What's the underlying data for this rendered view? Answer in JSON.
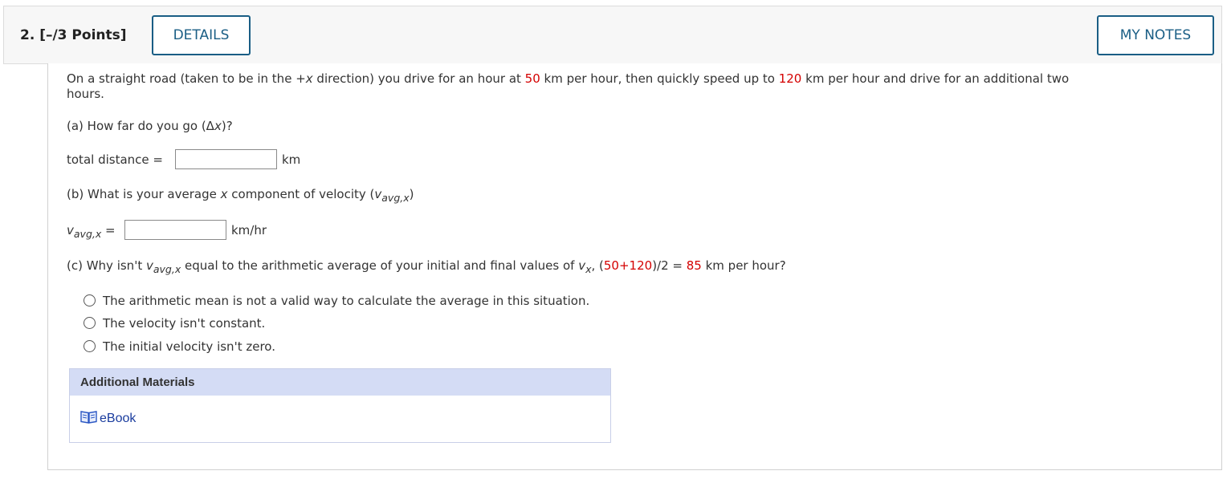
{
  "header": {
    "question_label": "2.  [–/3 Points]",
    "details_label": "DETAILS",
    "my_notes_label": "MY NOTES"
  },
  "question": {
    "intro_p1": "On a straight road (taken to be in the +",
    "intro_x": "x",
    "intro_p2": " direction) you drive for an hour at ",
    "speed1": "50",
    "intro_p3": " km per hour, then quickly speed up to ",
    "speed2": "120",
    "intro_p4": " km per hour and drive for an additional two",
    "intro_line2": "hours.",
    "part_a": {
      "prompt_p1": "(a) How far do you go (Δ",
      "prompt_x": "x",
      "prompt_p2": ")?",
      "label": "total distance =",
      "value": "",
      "unit": "km"
    },
    "part_b": {
      "prompt_p1": "(b) What is your average ",
      "prompt_x": "x",
      "prompt_p2": " component of velocity (",
      "prompt_v": "v",
      "prompt_sub": "avg,x",
      "prompt_p3": ")",
      "label_v": "v",
      "label_sub": "avg,x",
      "label_eq": " =",
      "value": "",
      "unit": "km/hr"
    },
    "part_c": {
      "p1": "(c) Why isn't ",
      "v": "v",
      "sub": "avg,x",
      "p2": " equal to the arithmetic average of your initial and final values of ",
      "v2": "v",
      "sub2": "x",
      "p3": ", (",
      "n1": "50",
      "plus": "+",
      "n2": "120",
      "p4": ")/2 = ",
      "n3": "85",
      "p5": " km per hour?",
      "options": [
        "The arithmetic mean is not a valid way to calculate the average in this situation.",
        "The velocity isn't constant.",
        "The initial velocity isn't zero."
      ]
    }
  },
  "additional_materials": {
    "title": "Additional Materials",
    "ebook_label": "eBook"
  },
  "colors": {
    "accent": "#1a5e85",
    "highlight_number": "#d40000",
    "materials_header": "#d4dcf5",
    "link": "#1a3c9e"
  }
}
